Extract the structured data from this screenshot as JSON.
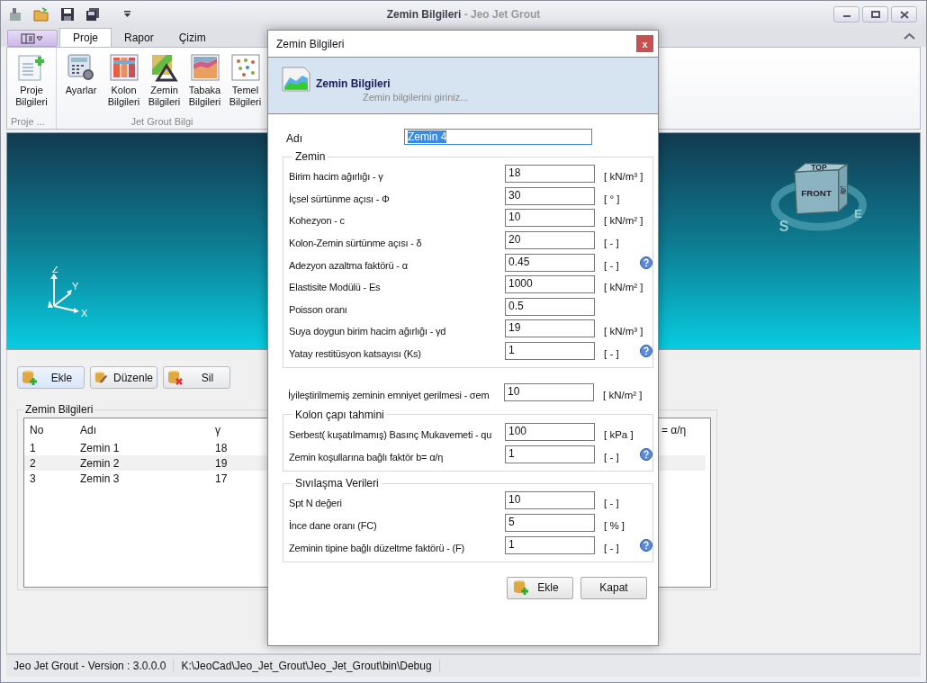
{
  "window": {
    "title": "Zemin Bilgileri",
    "title_suffix": "- Jeo Jet Grout"
  },
  "ribbon": {
    "tabs": [
      {
        "label": "Proje",
        "selected": true
      },
      {
        "label": "Rapor",
        "selected": false
      },
      {
        "label": "Çizim",
        "selected": false
      }
    ],
    "groups": [
      {
        "caption": "Proje ...",
        "items": [
          {
            "kind": "doc",
            "label": "Proje Bilgileri"
          }
        ]
      },
      {
        "caption": "Jet Grout Bilgi",
        "items": [
          {
            "kind": "calc",
            "label": "Ayarlar"
          },
          {
            "kind": "columns",
            "label": "Kolon Bilgileri"
          },
          {
            "kind": "soil",
            "label": "Zemin Bilgileri"
          },
          {
            "kind": "layers",
            "label": "Tabaka Bilgileri"
          },
          {
            "kind": "dots",
            "label": "Temel Bilgileri"
          }
        ]
      }
    ]
  },
  "viewport": {
    "axes": [
      "Z",
      "Y",
      "X"
    ],
    "cube": {
      "top": "TOP",
      "front": "FRONT",
      "right": "RIGHT",
      "south": "S",
      "east": "E"
    }
  },
  "actions": [
    {
      "kind": "add",
      "label": "Ekle"
    },
    {
      "kind": "edit",
      "label": "Düzenle"
    },
    {
      "kind": "delete",
      "label": "Sil"
    }
  ],
  "list": {
    "title": "Zemin Bilgileri",
    "columns": [
      "No",
      "Adı",
      "γ",
      "= α/η"
    ],
    "rows": [
      {
        "cells": [
          "1",
          "Zemin 1",
          "18"
        ],
        "selected": false
      },
      {
        "cells": [
          "2",
          "Zemin 2",
          "19"
        ],
        "selected": true
      },
      {
        "cells": [
          "3",
          "Zemin 3",
          "17"
        ],
        "selected": false
      }
    ]
  },
  "status_bar": [
    "Jeo Jet Grout - Version : 3.0.0.0",
    "K:\\JeoCad\\Jeo_Jet_Grout\\Jeo_Jet_Grout\\bin\\Debug"
  ],
  "dialog": {
    "title": "Zemin Bilgileri",
    "close": "x",
    "header": {
      "title": "Zemin Bilgileri",
      "subtitle": "Zemin  bilgilerini giriniz..."
    },
    "name_field": {
      "label": "Adı",
      "value": "Zemin 4"
    },
    "sections": [
      {
        "kind": "group",
        "title": "Zemin",
        "rows": [
          {
            "label": "Birim hacim ağırlığı - γ",
            "value": "18",
            "unit": "[ kN/m³ ]"
          },
          {
            "label": "İçsel sürtünme açısı - Φ",
            "value": "30",
            "unit": "[ ° ]"
          },
          {
            "label": "Kohezyon - c",
            "value": "10",
            "unit": "[ kN/m² ]"
          },
          {
            "label": "Kolon-Zemin sürtünme açısı - δ",
            "value": "20",
            "unit": "[ - ]"
          },
          {
            "label": "Adezyon azaltma faktörü - α",
            "value": "0.45",
            "unit": "[ - ]",
            "help": true
          },
          {
            "label": "Elastisite Modülü - Es",
            "value": "1000",
            "unit": "[ kN/m² ]"
          },
          {
            "label": "Poisson oranı",
            "value": "0.5"
          },
          {
            "label": "Suya doygun birim hacim ağırlığı -  γd",
            "value": "19",
            "unit": "[ kN/m³ ]"
          },
          {
            "label": "Yatay restitüsyon katsayısı (Ks)",
            "value": "1",
            "unit": "[ - ]",
            "help": true
          }
        ]
      },
      {
        "kind": "plain",
        "rows": [
          {
            "label": "İyileştirilmemiş zeminin emniyet gerilmesi - σem",
            "value": "10",
            "unit": "[ kN/m² ]"
          }
        ]
      },
      {
        "kind": "group",
        "title": "Kolon çapı tahmini",
        "rows": [
          {
            "label": "Serbest( kuşatılmamış) Basınç Mukavemeti - qu",
            "value": "100",
            "unit": "[ kPa ]"
          },
          {
            "label": "Zemin koşullarına bağlı faktör b= α/η",
            "value": "1",
            "unit": "[ - ]",
            "help": true
          }
        ]
      },
      {
        "kind": "group",
        "title": "Sıvılaşma Verileri",
        "rows": [
          {
            "label": "Spt N değeri",
            "value": "10",
            "unit": "[ - ]"
          },
          {
            "label": "İnce dane oranı (FC)",
            "value": "5",
            "unit": "[ % ]"
          },
          {
            "label": "Zeminin tipine bağlı düzeltme faktörü - (F)",
            "value": "1",
            "unit": "[ - ]",
            "help": true
          }
        ]
      }
    ],
    "buttons": [
      {
        "kind": "add",
        "label": "Ekle"
      },
      {
        "kind": "plain",
        "label": "Kapat"
      }
    ]
  }
}
